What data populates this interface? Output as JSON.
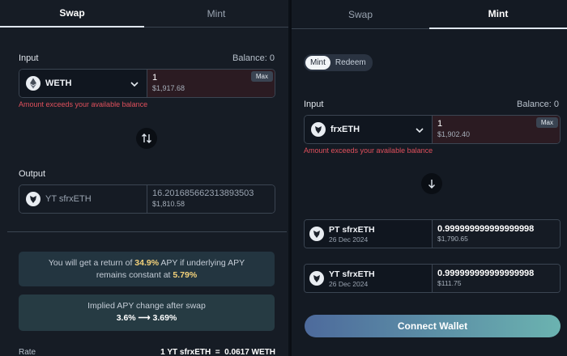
{
  "left": {
    "tabs": [
      {
        "label": "Swap"
      },
      {
        "label": "Mint"
      }
    ],
    "input_label": "Input",
    "balance": "Balance: 0",
    "input_token": "WETH",
    "input_amount": "1",
    "input_usd": "$1,917.68",
    "max_label": "Max",
    "error": "Amount exceeds your available balance",
    "output_label": "Output",
    "output_token": "YT sfrxETH",
    "output_amount": "16.201685662313893503",
    "output_usd": "$1,810.58",
    "return_pre": "You will get a return of",
    "return_apy": "34.9%",
    "return_mid": "APY if underlying APY",
    "return_post": "remains constant at",
    "constant_apy": "5.79%",
    "implied_label": "Implied APY change after swap",
    "implied_change": "3.6% ⟶ 3.69%",
    "rate_label": "Rate",
    "rate_value": "1 YT sfrxETH  =  0.0617 WETH"
  },
  "right": {
    "tabs": [
      {
        "label": "Swap"
      },
      {
        "label": "Mint"
      }
    ],
    "mode_toggle": [
      {
        "label": "Mint"
      },
      {
        "label": "Redeem"
      }
    ],
    "input_label": "Input",
    "balance": "Balance: 0",
    "input_token": "frxETH",
    "input_amount": "1",
    "input_usd": "$1,902.40",
    "max_label": "Max",
    "error": "Amount exceeds your available balance",
    "outputs": [
      {
        "name": "PT sfrxETH",
        "date": "26 Dec 2024",
        "amount": "0.999999999999999998",
        "usd": "$1,790.65"
      },
      {
        "name": "YT sfrxETH",
        "date": "26 Dec 2024",
        "amount": "0.999999999999999998",
        "usd": "$111.75"
      }
    ],
    "connect_label": "Connect Wallet"
  },
  "colors": {
    "error": "#e0505c",
    "highlight": "#f4d27a",
    "accent_start": "#4d6a9c",
    "accent_end": "#6bb3b0"
  },
  "icons": [
    "eth-icon",
    "frax-icon",
    "chevron-down-icon",
    "swap-arrows-icon",
    "arrow-down-icon"
  ]
}
